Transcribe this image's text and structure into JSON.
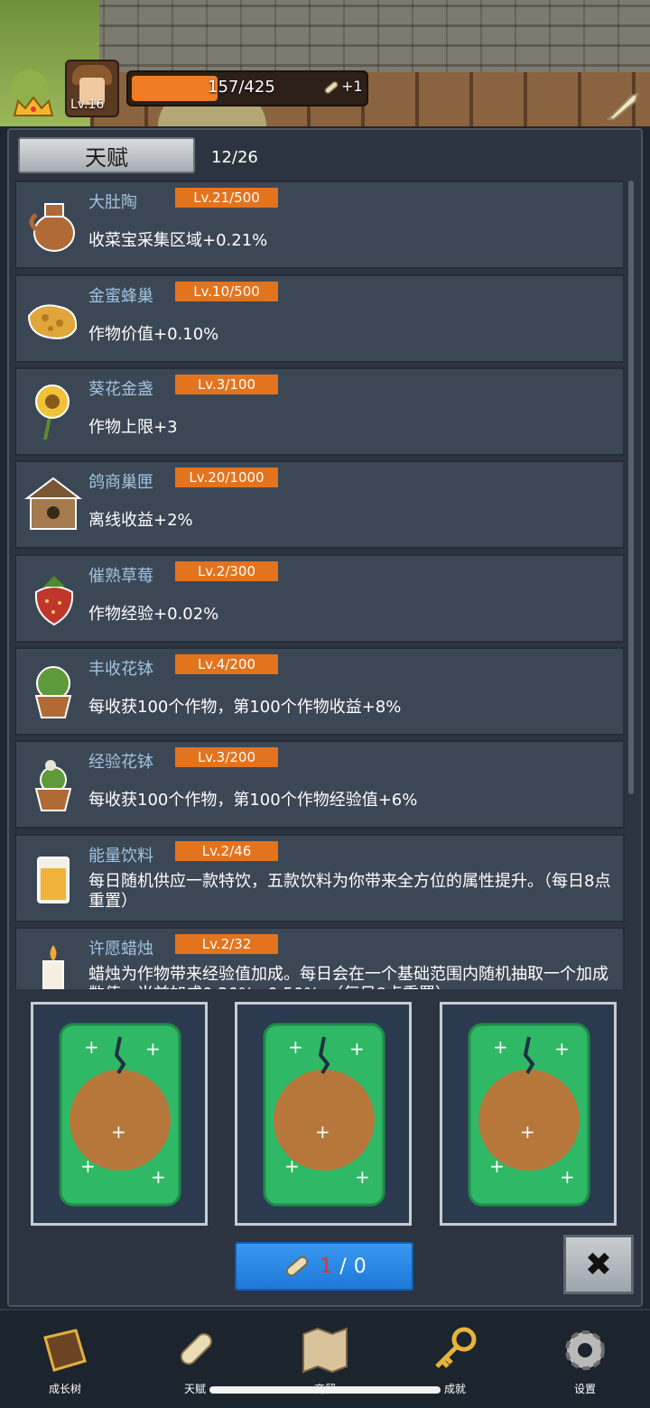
{
  "header": {
    "level_label": "Lv.16",
    "xp_text": "157/425",
    "xp_fraction": 0.37,
    "scroll_bonus": "+1"
  },
  "panel": {
    "tab_label": "天赋",
    "talent_count": "12/26"
  },
  "talents": [
    {
      "name": "大肚陶",
      "level": "Lv.21/500",
      "desc": "收菜宝采集区域+0.21%",
      "icon": "clay-jar-icon"
    },
    {
      "name": "金蜜蜂巢",
      "level": "Lv.10/500",
      "desc": "作物价值+0.10%",
      "icon": "honeycomb-icon"
    },
    {
      "name": "葵花金盏",
      "level": "Lv.3/100",
      "desc": "作物上限+3",
      "icon": "sunflower-icon"
    },
    {
      "name": "鸽商巢匣",
      "level": "Lv.20/1000",
      "desc": "离线收益+2%",
      "icon": "birdhouse-icon"
    },
    {
      "name": "催熟草莓",
      "level": "Lv.2/300",
      "desc": "作物经验+0.02%",
      "icon": "strawberry-icon"
    },
    {
      "name": "丰收花钵",
      "level": "Lv.4/200",
      "desc": "每收获100个作物，第100个作物收益+8%",
      "icon": "flower-pot-icon"
    },
    {
      "name": "经验花钵",
      "level": "Lv.3/200",
      "desc": "每收获100个作物，第100个作物经验值+6%",
      "icon": "flower-pot-white-icon"
    },
    {
      "name": "能量饮料",
      "level": "Lv.2/46",
      "desc": "每日随机供应一款特饮，五款饮料为你带来全方位的属性提升。（每日8点重置）",
      "icon": "energy-drink-icon"
    },
    {
      "name": "许愿蜡烛",
      "level": "Lv.2/32",
      "desc": "蜡烛为作物带来经验值加成。每日会在一个基础范围内随机抽取一个加成数值，当前加成0.30%~0.50%。（每日8点重置）",
      "icon": "candle-icon"
    }
  ],
  "cards": [
    {
      "label": "card-1"
    },
    {
      "label": "card-2"
    },
    {
      "label": "card-3"
    }
  ],
  "draw": {
    "current": "1",
    "separator": " / ",
    "total": "0"
  },
  "close_glyph": "✖",
  "nav": [
    {
      "label": "成长树",
      "icon": "book-icon"
    },
    {
      "label": "天赋",
      "icon": "scroll-icon"
    },
    {
      "label": "商贸",
      "icon": "map-icon"
    },
    {
      "label": "成就",
      "icon": "key-icon"
    },
    {
      "label": "设置",
      "icon": "gear-icon"
    }
  ],
  "colors": {
    "accent_orange": "#e4731e",
    "name_blue": "#9fc3e0",
    "panel": "#2b3440",
    "card_green": "#2fb866",
    "button_blue": "#2a88e6"
  }
}
